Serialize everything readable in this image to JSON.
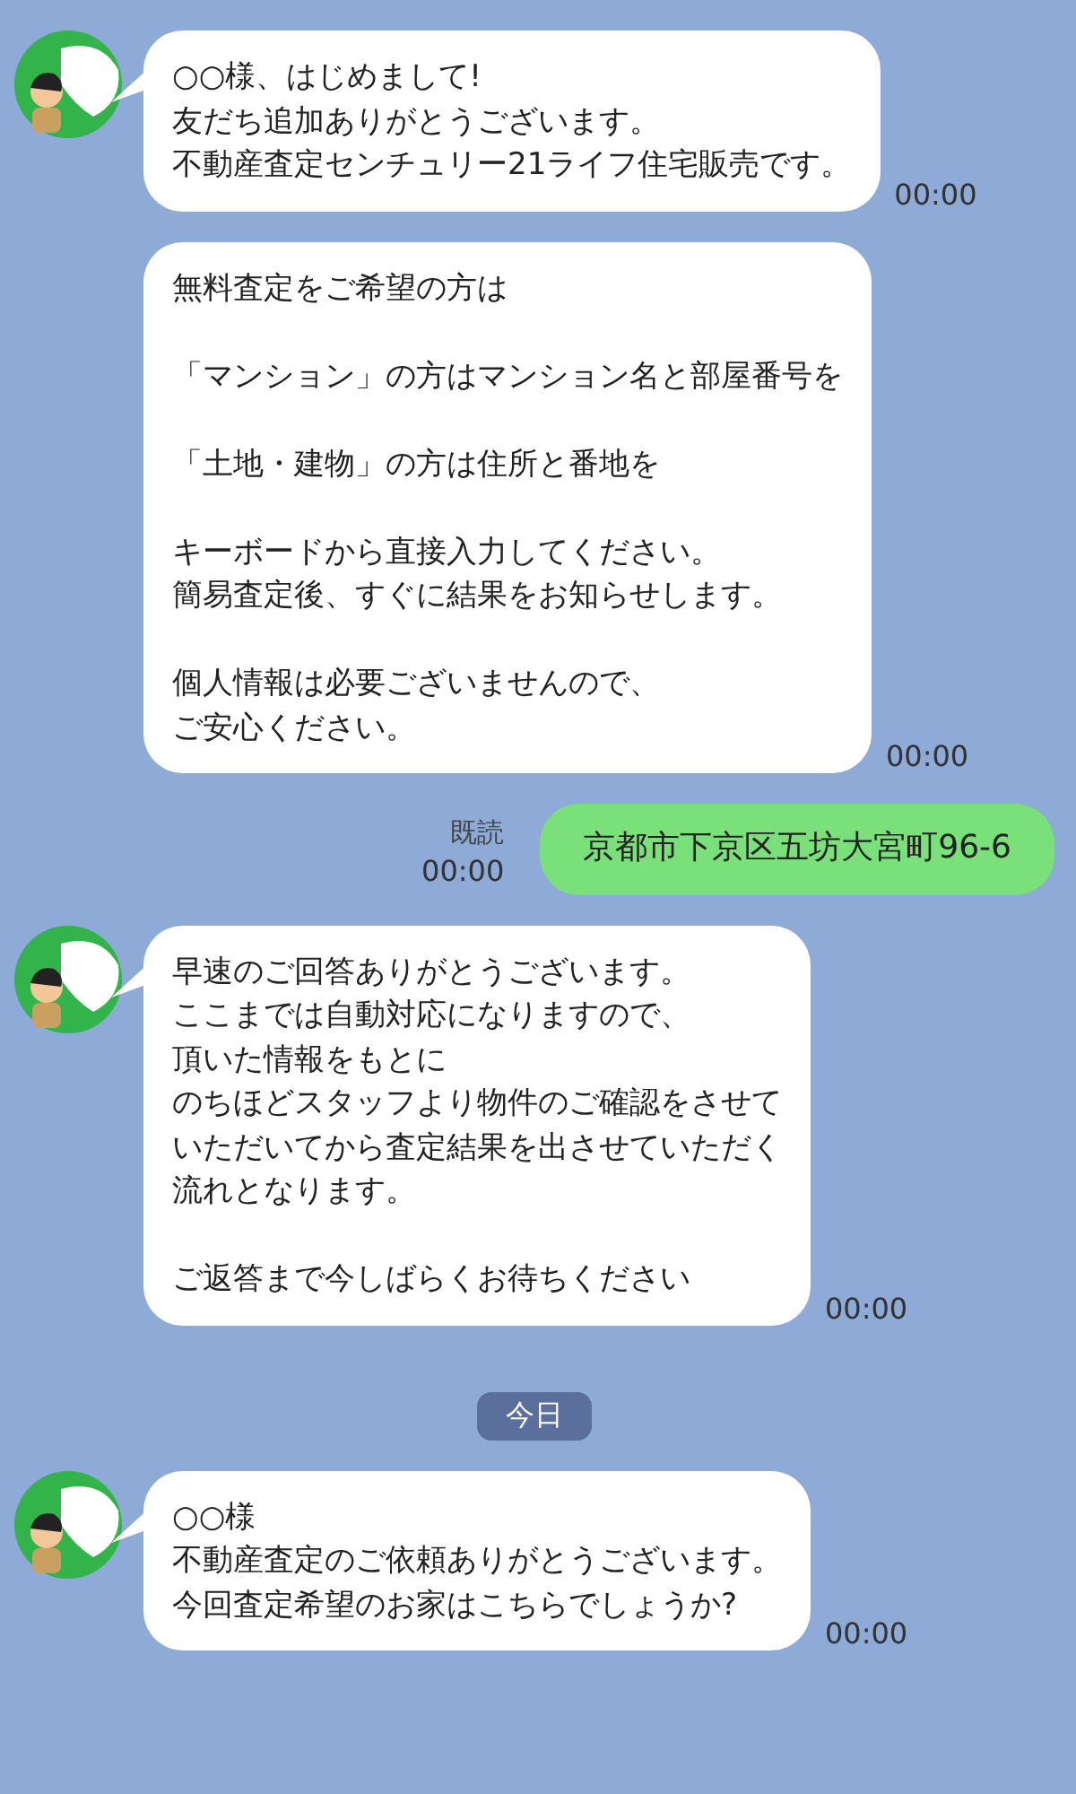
{
  "messages": [
    {
      "kind": "incoming",
      "avatar": true,
      "paragraphs": [
        [
          "○○様、はじめまして!",
          "友だち追加ありがとうございます。",
          "不動産査定センチュリー21ライフ住宅販売です。"
        ]
      ],
      "time": "00:00"
    },
    {
      "kind": "incoming",
      "avatar": false,
      "paragraphs": [
        [
          "無料査定をご希望の方は"
        ],
        [
          "「マンション」の方はマンション名と部屋番号を"
        ],
        [
          "「土地・建物」の方は住所と番地を"
        ],
        [
          "キーボードから直接入力してください。",
          "簡易査定後、すぐに結果をお知らせします。"
        ],
        [
          "個人情報は必要ございませんので、",
          "ご安心ください。"
        ]
      ],
      "time": "00:00"
    },
    {
      "kind": "outgoing",
      "read": "既読",
      "paragraphs": [
        [
          "京都市下京区五坊大宮町96-6"
        ]
      ],
      "time": "00:00"
    },
    {
      "kind": "incoming",
      "avatar": true,
      "paragraphs": [
        [
          "早速のご回答ありがとうございます。",
          "ここまでは自動対応になりますので、",
          "頂いた情報をもとに",
          "のちほどスタッフより物件のご確認をさせて",
          "いただいてから査定結果を出させていただく",
          "流れとなります。"
        ],
        [
          "ご返答まで今しばらくお待ちください"
        ]
      ],
      "time": "00:00"
    },
    {
      "kind": "date",
      "text": "今日"
    },
    {
      "kind": "incoming",
      "avatar": true,
      "paragraphs": [
        [
          "○○様",
          "不動産査定のご依頼ありがとうございます。",
          "今回査定希望のお家はこちらでしょうか?"
        ]
      ],
      "time": "00:00"
    }
  ]
}
